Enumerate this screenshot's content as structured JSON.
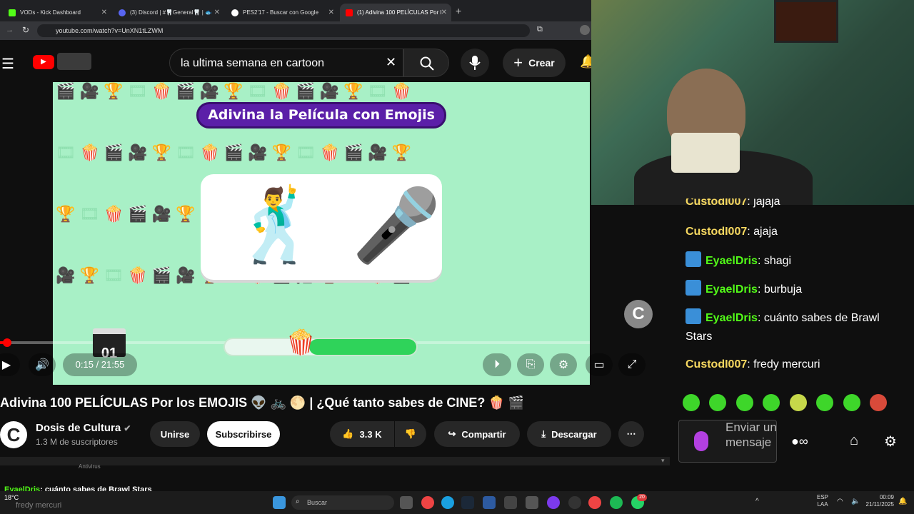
{
  "browser": {
    "tabs": [
      {
        "label": "VODs - Kick Dashboard",
        "color": "#53fc18"
      },
      {
        "label": "(3) Discord | #🦷General🦷 | 🐟",
        "color": "#5865f2"
      },
      {
        "label": "PES2'17 - Buscar con Google",
        "color": "#4285f4"
      },
      {
        "label": "(1) Adivina 100 PELÍCULAS Por l",
        "color": "#ff0000"
      }
    ],
    "url": "youtube.com/watch?v=UnXN1tLZWM"
  },
  "youtube": {
    "search_query": "la ultima semana en cartoon",
    "create_label": "Crear",
    "video": {
      "banner": "Adivina la Película con Emojis",
      "emojis": [
        "🕺",
        "🎤"
      ],
      "clapper_number": "01",
      "time": "0:15 / 21:55",
      "progress_pct": 1.1
    },
    "title": "Adivina 100 PELÍCULAS Por los EMOJIS 👽 🚲 🌕 | ¿Qué tanto sabes de CINE? 🍿 🎬",
    "channel": {
      "avatar_letter": "C",
      "name": "Dosis de Cultura",
      "subs": "1.3 M de suscriptores"
    },
    "buttons": {
      "join": "Unirse",
      "subscribe": "Subscribirse",
      "likes": "3.3 K",
      "share": "Compartir",
      "download": "Descargar"
    },
    "below_label": "Antivirus"
  },
  "chat": {
    "messages": [
      {
        "user": "CustodI007",
        "text": "jajaja",
        "color": "#f6d860",
        "badge": false
      },
      {
        "user": "CustodI007",
        "text": "ajaja",
        "color": "#f6d860",
        "badge": false
      },
      {
        "user": "EyaelDris",
        "text": "shagi",
        "color": "#53fc18",
        "badge": true
      },
      {
        "user": "EyaelDris",
        "text": "burbuja",
        "color": "#53fc18",
        "badge": true
      },
      {
        "user": "EyaelDris",
        "text": "cuánto sabes de Brawl Stars",
        "color": "#53fc18",
        "badge": true
      },
      {
        "user": "CustodI007",
        "text": "fredy mercuri",
        "color": "#f6d860",
        "badge": false
      }
    ],
    "input_placeholder": "Enviar un mensaje",
    "overlay_user": "EyaelDris",
    "overlay_text": "cuánto sabes de Brawl Stars",
    "overlay_line2": "fredy mercuri"
  },
  "taskbar": {
    "search_placeholder": "Buscar",
    "weather": "18°C",
    "lang_line1": "ESP",
    "lang_line2": "LAA",
    "time": "00:09",
    "date": "21/11/2025",
    "notif_count": "20"
  }
}
